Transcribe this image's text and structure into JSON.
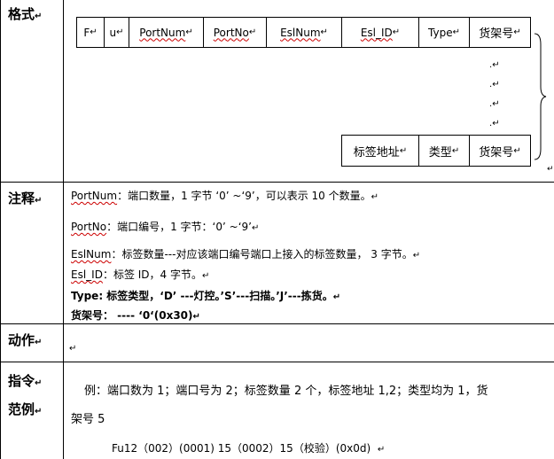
{
  "sections": {
    "format": "格式",
    "notes": "注释",
    "action": "动作",
    "example_l1": "指令",
    "example_l2": "范例"
  },
  "format_table": {
    "top_row": [
      "F",
      "u",
      "PortNum",
      "PortNo",
      "EslNum",
      "Esl_ID",
      "Type",
      "货架号"
    ],
    "bottom_row": [
      "标签地址",
      "类型",
      "货架号"
    ],
    "ellipsis": "."
  },
  "notes": {
    "portnum_term": "PortNum",
    "portnum_text": "：端口数量，1 字节  ‘0’ ~‘9’，可以表示 10 个数量。",
    "portno_term": "PortNo",
    "portno_text": "：端口编号，1 字节：‘0’ ~‘9’",
    "eslnum_term": "EslNum",
    "eslnum_text": "：标签数量---对应该端口编号端口上接入的标签数量， 3 字节。",
    "eslid_term": "Esl_ID",
    "eslid_text": "：标签 ID，4 字节。",
    "type_line": "Type: 标签类型，‘D’ ---灯控。’S’---扫描。’J’---拣货。",
    "shelf_line": "货架号： ----  ‘0‘(0x30)"
  },
  "example": {
    "line1": "例：端口数为 1；端口号为 2；标签数量 2 个，标签地址 1,2；类型均为 1，货",
    "line2": "架号 5",
    "command": "Fu12（002）(0001) 15（0002）15（校验）(0x0d)"
  },
  "paragraph_mark": "↵"
}
